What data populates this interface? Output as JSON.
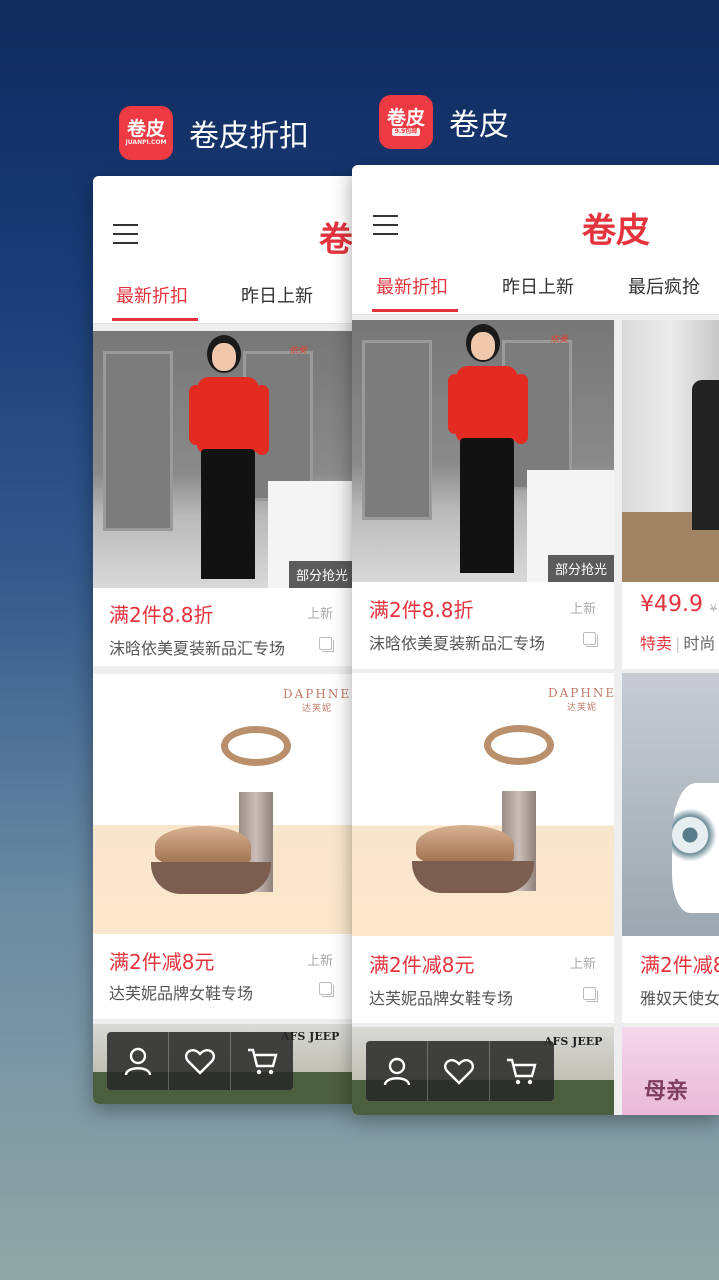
{
  "left_app": {
    "icon_text": "卷皮",
    "icon_subtext": "JUANPI.COM",
    "name": "卷皮折扣",
    "brand_logo": "卷",
    "tabs": [
      {
        "label": "最新折扣",
        "active": true
      },
      {
        "label": "昨日上新",
        "active": false
      }
    ],
    "products": [
      {
        "price_text": "满2件8.8折",
        "new_label": "上新",
        "title": "沫晗依美夏装新品汇专场",
        "badge": "部分抢光",
        "image": "woman-in-red-top"
      },
      {
        "price_text": "满2件减8元",
        "new_label": "上新",
        "title": "达芙妮品牌女鞋专场",
        "image": "high-heel-sandal",
        "brand_mark": "DAPHNE",
        "brand_mark_cn": "达芙妮"
      },
      {
        "image": "green-shirt",
        "brand_mark": "AFS JEEP"
      }
    ]
  },
  "right_app": {
    "icon_text": "卷皮",
    "icon_subtext": "9.9包邮",
    "name": "卷皮",
    "brand_logo": "卷皮",
    "tabs": [
      {
        "label": "最新折扣",
        "active": true
      },
      {
        "label": "昨日上新",
        "active": false
      },
      {
        "label": "最后疯抢",
        "active": false
      }
    ],
    "products_col1": [
      {
        "price_text": "满2件8.8折",
        "new_label": "上新",
        "title": "沫晗依美夏装新品汇专场",
        "badge": "部分抢光",
        "image": "woman-in-red-top"
      },
      {
        "price_text": "满2件减8元",
        "new_label": "上新",
        "title": "达芙妮品牌女鞋专场",
        "image": "high-heel-sandal",
        "brand_mark": "DAPHNE",
        "brand_mark_cn": "达芙妮"
      },
      {
        "image": "green-shirt",
        "brand_mark": "AFS JEEP"
      }
    ],
    "products_col2": [
      {
        "price": "¥49.9",
        "old_price": "¥",
        "tag_hot": "特卖",
        "tag_text": "时尚",
        "image": "store-photo"
      },
      {
        "price_text": "满2件减8",
        "title": "雅奴天使女",
        "image": "floral-dress"
      },
      {
        "image": "pink-banner",
        "banner_text": "母亲"
      }
    ]
  },
  "bottom_bar": {
    "icons": [
      "user-icon",
      "heart-icon",
      "cart-icon"
    ]
  },
  "colors": {
    "brand_red": "#e5333d",
    "icon_red": "#ee3a43"
  }
}
